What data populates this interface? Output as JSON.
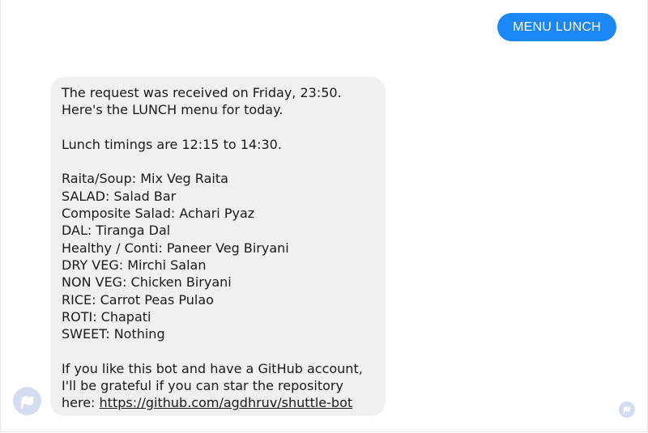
{
  "sent_message": {
    "text": "MENU LUNCH"
  },
  "received_message": {
    "intro": [
      "The request was received on Friday, 23:50.",
      "Here's the LUNCH menu for today."
    ],
    "timings": "Lunch timings are 12:15 to 14:30.",
    "menu": [
      "Raita/Soup: Mix Veg Raita",
      "SALAD: Salad Bar",
      "Composite Salad: Achari Pyaz",
      "DAL: Tiranga Dal",
      "Healthy / Conti: Paneer Veg Biryani",
      "DRY VEG: Mirchi Salan",
      "NON VEG: Chicken Biryani",
      "RICE: Carrot Peas Pulao",
      "ROTI: Chapati",
      "SWEET: Nothing"
    ],
    "footer": [
      "If you like this bot and have a GitHub account,",
      "I'll be grateful if you can star the repository"
    ],
    "link_prefix": "here: ",
    "link_text": "https://github.com/agdhruv/shuttle-bot"
  },
  "icons": {
    "avatar": "bot-avatar-icon",
    "seen": "seen-indicator-icon"
  },
  "colors": {
    "sent_bubble": "#1b86f6",
    "received_bubble": "#f0f0f0",
    "avatar_bg": "#d6dcf0"
  }
}
